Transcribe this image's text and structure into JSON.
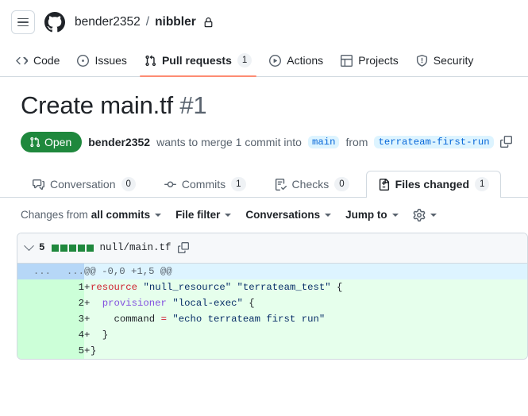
{
  "topbar": {
    "menu_label": "Open navigation menu",
    "logo_name": "github-logo",
    "owner": "bender2352",
    "separator": "/",
    "repo": "nibbler",
    "visibility": "private"
  },
  "reponav": {
    "items": [
      {
        "label": "Code",
        "icon": "code-icon",
        "count": null,
        "selected": false
      },
      {
        "label": "Issues",
        "icon": "issue-opened-icon",
        "count": null,
        "selected": false
      },
      {
        "label": "Pull requests",
        "icon": "git-pull-request-icon",
        "count": "1",
        "selected": true
      },
      {
        "label": "Actions",
        "icon": "play-icon",
        "count": null,
        "selected": false
      },
      {
        "label": "Projects",
        "icon": "table-icon",
        "count": null,
        "selected": false
      },
      {
        "label": "Security",
        "icon": "shield-icon",
        "count": null,
        "selected": false
      }
    ],
    "active_underline_color": "#fd8c73"
  },
  "pr": {
    "title": "Create main.tf",
    "number": "#1",
    "state": "Open",
    "state_icon": "git-pull-request-icon",
    "state_color": "#1f883d",
    "author": "bender2352",
    "action_text": "wants to merge 1 commit into",
    "base_branch": "main",
    "from_text": "from",
    "head_branch": "terrateam-first-run",
    "copy_icon": "copy-icon"
  },
  "prtabs": {
    "items": [
      {
        "label": "Conversation",
        "icon": "comment-discussion-icon",
        "count": "0",
        "selected": false
      },
      {
        "label": "Commits",
        "icon": "git-commit-icon",
        "count": "1",
        "selected": false
      },
      {
        "label": "Checks",
        "icon": "checklist-icon",
        "count": "0",
        "selected": false
      },
      {
        "label": "Files changed",
        "icon": "file-diff-icon",
        "count": "1",
        "selected": true
      }
    ]
  },
  "difftoolbar": {
    "changes_from_label": "Changes from",
    "changes_from_value": "all commits",
    "file_filter": "File filter",
    "conversations": "Conversations",
    "jump_to": "Jump to",
    "settings_icon": "gear-icon"
  },
  "file": {
    "collapse_icon": "chevron-down-icon",
    "changes_count": "5",
    "stat_blocks_added": 5,
    "stat_block_color": "#1f883d",
    "path": "null/main.tf",
    "copy_path_icon": "copy-icon"
  },
  "diff": {
    "hunk": {
      "old_gutter": "...",
      "new_gutter": "...",
      "header": "@@ -0,0 +1,5 @@"
    },
    "lines": [
      {
        "number": "1",
        "marker": "+",
        "type": "add",
        "tokens": [
          {
            "text": "resource",
            "kind": "kw"
          },
          {
            "text": " ",
            "kind": "plain"
          },
          {
            "text": "\"null_resource\"",
            "kind": "str"
          },
          {
            "text": " ",
            "kind": "plain"
          },
          {
            "text": "\"terrateam_test\"",
            "kind": "str"
          },
          {
            "text": " {",
            "kind": "plain"
          }
        ]
      },
      {
        "number": "2",
        "marker": "+",
        "type": "add",
        "tokens": [
          {
            "text": "  ",
            "kind": "plain"
          },
          {
            "text": "provisioner",
            "kind": "fn"
          },
          {
            "text": " ",
            "kind": "plain"
          },
          {
            "text": "\"local-exec\"",
            "kind": "str"
          },
          {
            "text": " {",
            "kind": "plain"
          }
        ]
      },
      {
        "number": "3",
        "marker": "+",
        "type": "add",
        "tokens": [
          {
            "text": "    command ",
            "kind": "plain"
          },
          {
            "text": "=",
            "kind": "op"
          },
          {
            "text": " ",
            "kind": "plain"
          },
          {
            "text": "\"echo terrateam first run\"",
            "kind": "str"
          }
        ]
      },
      {
        "number": "4",
        "marker": "+",
        "type": "add",
        "tokens": [
          {
            "text": "  }",
            "kind": "plain"
          }
        ]
      },
      {
        "number": "5",
        "marker": "+",
        "type": "add",
        "tokens": [
          {
            "text": "}",
            "kind": "plain"
          }
        ]
      }
    ]
  }
}
